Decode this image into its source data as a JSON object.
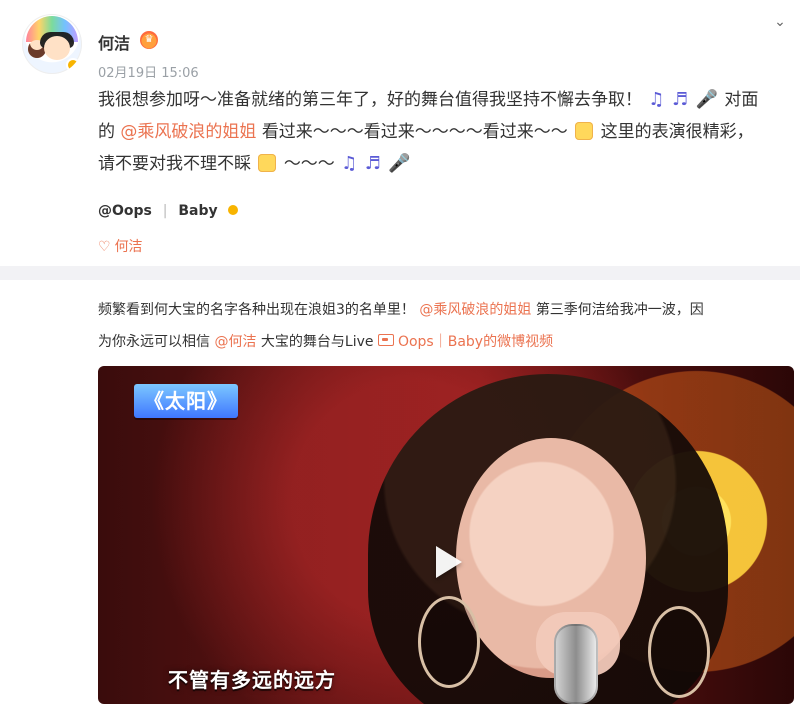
{
  "post": {
    "author": "何洁",
    "timestamp": "02月19日 15:06",
    "content": {
      "line1_prefix": "我很想参加呀～准备就绪的第三年了，好的舞台值得我坚持不懈去争取！",
      "line1_suffix": "对面",
      "line2_prefix": "的",
      "line2_mention": "@乘风破浪的姐姐",
      "line2_text": "看过来～～～看过来～～～～看过来～～",
      "line2_suffix": "这里的表演很精彩，",
      "line3_text": "请不要对我不理不睬",
      "line3_suffix": "～～～"
    },
    "repost": {
      "from_user": "@Oops",
      "separator": "|",
      "from_user_suffix": "Baby",
      "love_tag": "何洁"
    },
    "repost_text": {
      "line1_prefix": "频繁看到何大宝的名字各种出现在浪姐3的名单里！",
      "mention_show": "@乘风破浪的姐姐",
      "line1_suffix": "第三季何洁给我冲一波，因",
      "line2_prefix": "为你永远可以相信",
      "mention_user": "@何洁",
      "line2_mid": "大宝的舞台与Live",
      "video_link": "Oops｜Baby的微博视频"
    },
    "video": {
      "title": "《太阳》",
      "subtitle": "不管有多远的远方"
    }
  },
  "icons": {
    "more": "chevron-down-icon",
    "play": "play-icon",
    "link": "video-link-icon",
    "heart": "heart-icon",
    "verified": "verified-icon"
  },
  "colors": {
    "mention": "#eb7350",
    "meta": "#9aa0a6",
    "divider": "#f2f2f5"
  }
}
